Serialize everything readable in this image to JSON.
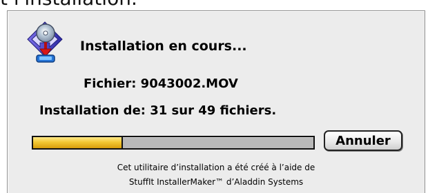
{
  "top_text": "t l'installation.",
  "dialog": {
    "icon": "installer-disc-arrow-icon",
    "title": "Installation en cours...",
    "file_label": "Fichier: 9043002.MOV",
    "count_label": "Installation de: 31 sur 49 fichiers.",
    "progress_value": 0.32,
    "cancel_label": "Annuler",
    "credit_line1": "Cet utilitaire d’installation a été créé à l’aide de",
    "credit_line2": "StuffIt InstallerMaker™ d’Aladdin Systems"
  },
  "colors": {
    "dialog_background": "#ececec",
    "progress_fill": "#f3c833",
    "progress_track": "#b9b9b9"
  }
}
